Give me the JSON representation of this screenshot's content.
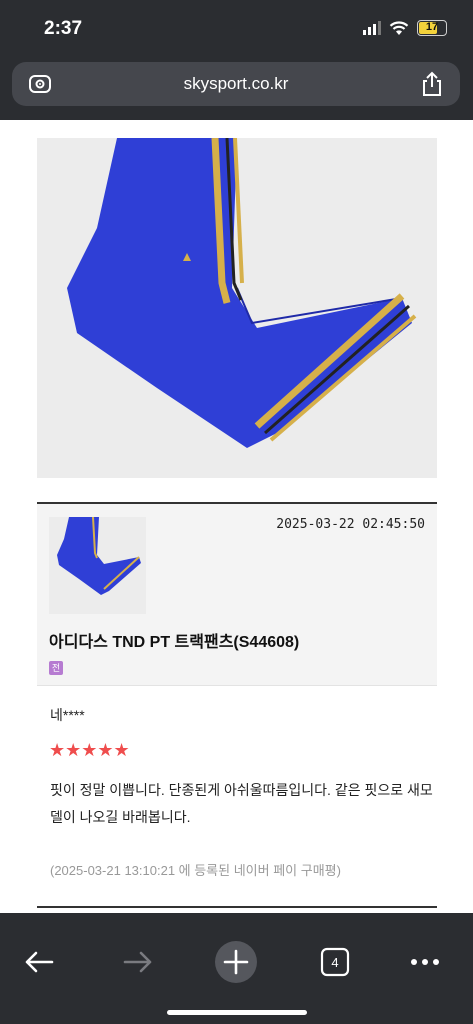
{
  "status_bar": {
    "time": "2:37",
    "battery": "17"
  },
  "browser": {
    "url": "skysport.co.kr",
    "tab_count": "4"
  },
  "product_card": {
    "date": "2025-03-22 02:45:50",
    "title": "아디다스 TND PT 트랙팬츠(S44608)",
    "badge": "전"
  },
  "review": {
    "reviewer": "네****",
    "rating": 5,
    "stars": "★★★★★",
    "body": "핏이 정말 이쁩니다. 단종된게 아쉬울따름입니다. 같은 핏으로 새모델이 나오길 바래봅니다.",
    "meta": "(2025-03-21 13:10:21 에 등록된 네이버 페이 구매평)"
  },
  "colors": {
    "accent_star": "#ef4d4d",
    "badge": "#b67bd1",
    "pants_blue": "#2f3fd6",
    "stripe_gold": "#d6b04a"
  }
}
